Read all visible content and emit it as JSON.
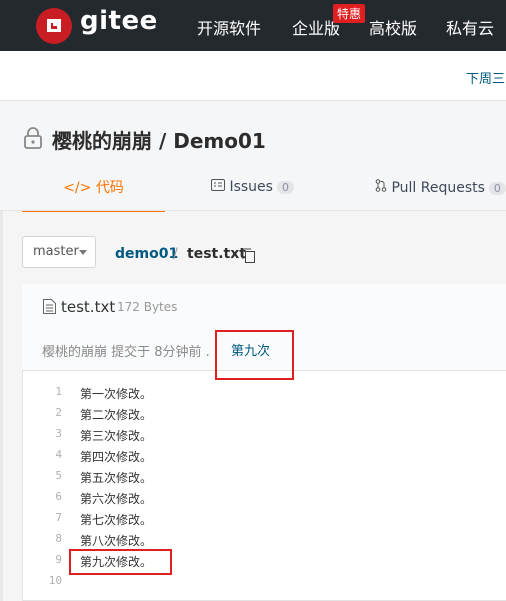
{
  "nav": {
    "brand": "gitee",
    "items": [
      "开源软件",
      "企业版",
      "高校版",
      "私有云"
    ],
    "hot_badge": "特惠"
  },
  "promo": {
    "text": "下周三"
  },
  "repo": {
    "title": "樱桃的崩崩 / Demo01",
    "tabs": {
      "code": "代码",
      "issues": "Issues",
      "issues_count": "0",
      "pulls": "Pull Requests",
      "pulls_count": "0"
    }
  },
  "branch": {
    "name": "master"
  },
  "path": {
    "repo": "demo01",
    "sep": "/",
    "file": "test.txt"
  },
  "file": {
    "name": "test.txt",
    "size": "172 Bytes",
    "commit_info": "樱桃的崩崩 提交于 8分钟前 .",
    "commit_message": "第九次"
  },
  "code_lines": [
    {
      "n": "1",
      "text": "第一次修改。"
    },
    {
      "n": "2",
      "text": "第二次修改。"
    },
    {
      "n": "3",
      "text": "第三次修改。"
    },
    {
      "n": "4",
      "text": "第四次修改。"
    },
    {
      "n": "5",
      "text": "第五次修改。"
    },
    {
      "n": "6",
      "text": "第六次修改。"
    },
    {
      "n": "7",
      "text": "第七次修改。"
    },
    {
      "n": "8",
      "text": "第八次修改。"
    },
    {
      "n": "9",
      "text": "第九次修改。"
    },
    {
      "n": "10",
      "text": ""
    }
  ],
  "colors": {
    "nav_bg": "#24292e",
    "accent": "#fe7300",
    "link": "#005980",
    "highlight_box": "#e02020"
  }
}
